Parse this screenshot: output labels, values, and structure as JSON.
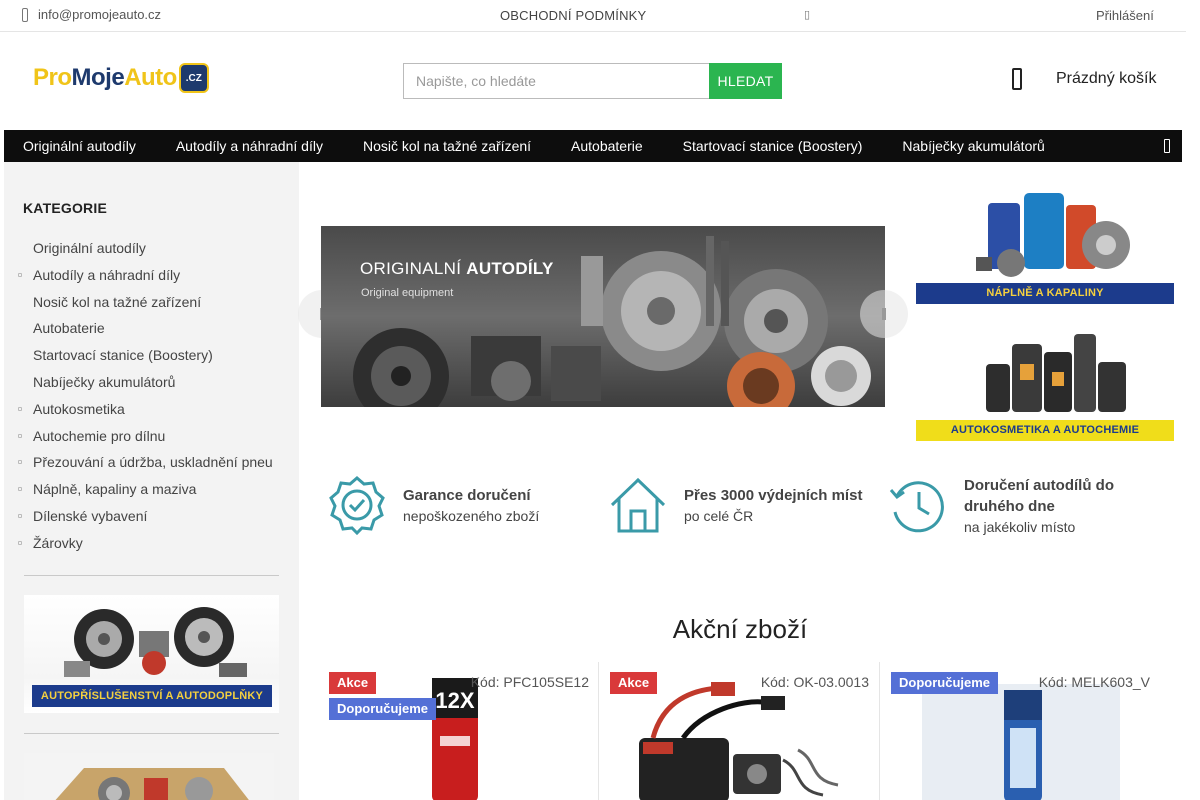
{
  "topbar": {
    "email": "info@promojeauto.cz",
    "terms": "OBCHODNÍ PODMÍNKY",
    "login": "Přihlášení"
  },
  "logo": {
    "pro": "Pro",
    "moje": "Moje",
    "auto": "Auto",
    "badge": ".CZ"
  },
  "search": {
    "placeholder": "Napište, co hledáte",
    "button": "HLEDAT"
  },
  "cart": {
    "label": "Prázdný košík"
  },
  "nav": {
    "items": [
      "Originální autodíly",
      "Autodíly a náhradní díly",
      "Nosič kol na tažné zařízení",
      "Autobaterie",
      "Startovací stanice (Boostery)",
      "Nabíječky akumulátorů"
    ]
  },
  "sidebar": {
    "title": "KATEGORIE",
    "items": [
      {
        "label": "Originální autodíly",
        "bullet": false
      },
      {
        "label": "Autodíly a náhradní díly",
        "bullet": true
      },
      {
        "label": "Nosič kol na tažné zařízení",
        "bullet": false
      },
      {
        "label": "Autobaterie",
        "bullet": false
      },
      {
        "label": "Startovací stanice (Boostery)",
        "bullet": false
      },
      {
        "label": "Nabíječky akumulátorů",
        "bullet": false
      },
      {
        "label": "Autokosmetika",
        "bullet": true
      },
      {
        "label": "Autochemie pro dílnu",
        "bullet": true
      },
      {
        "label": "Přezouvání a údržba, uskladnění pneu",
        "bullet": true
      },
      {
        "label": "Náplně, kapaliny a maziva",
        "bullet": true
      },
      {
        "label": "Dílenské vybavení",
        "bullet": true
      },
      {
        "label": "Žárovky",
        "bullet": true
      }
    ],
    "banner": "AUTOPŘÍSLUŠENSTVÍ A AUTODOPLŇKY"
  },
  "hero": {
    "title_a": "ORIGINALNÍ",
    "title_b": "AUTODÍLY",
    "subtitle": "Original equipment"
  },
  "promos": {
    "fluids": "NÁPLNĚ A KAPALINY",
    "cosmetics": "AUTOKOSMETIKA A AUTOCHEMIE"
  },
  "features": [
    {
      "head": "Garance doručení",
      "sub": "nepoškozeného zboží"
    },
    {
      "head": "Přes 3000 výdejních míst",
      "sub": "po celé ČR"
    },
    {
      "head": "Doručení autodílů do druhého dne",
      "sub": "na jakékoliv místo"
    }
  ],
  "section": {
    "title": "Akční zboží"
  },
  "products": [
    {
      "badges": [
        "Akce",
        "Doporučujeme"
      ],
      "code": "Kód: PFC105SE12",
      "can_text": "12X"
    },
    {
      "badges": [
        "Akce"
      ],
      "code": "Kód: OK-03.0013"
    },
    {
      "badges": [
        "Doporučujeme"
      ],
      "code": "Kód: MELK603_V"
    }
  ],
  "colors": {
    "accent_green": "#2bb550",
    "nav_bg": "#0d0d0d",
    "badge_sale": "#d9393a",
    "badge_rec": "#5470d6",
    "brand_navy": "#1e3a6d",
    "brand_yellow": "#f0c419",
    "feature_icon": "#3a9aa8"
  }
}
